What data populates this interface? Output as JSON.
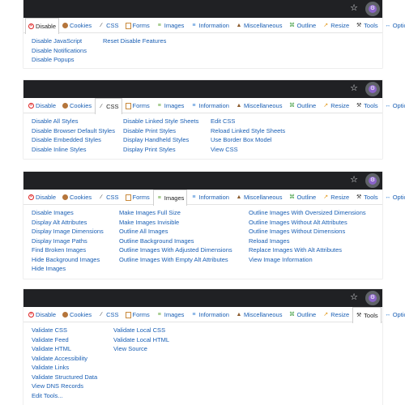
{
  "tabs": [
    {
      "key": "disable",
      "label": "Disable",
      "icon": "disable-icon"
    },
    {
      "key": "cookies",
      "label": "Cookies",
      "icon": "cookie-icon"
    },
    {
      "key": "css",
      "label": "CSS",
      "icon": "brush-icon"
    },
    {
      "key": "forms",
      "label": "Forms",
      "icon": "form-icon"
    },
    {
      "key": "images",
      "label": "Images",
      "icon": "image-icon"
    },
    {
      "key": "information",
      "label": "Information",
      "icon": "info-icon"
    },
    {
      "key": "miscellaneous",
      "label": "Miscellaneous",
      "icon": "misc-icon"
    },
    {
      "key": "outline",
      "label": "Outline",
      "icon": "outline-icon"
    },
    {
      "key": "resize",
      "label": "Resize",
      "icon": "resize-icon"
    },
    {
      "key": "tools",
      "label": "Tools",
      "icon": "tools-icon"
    },
    {
      "key": "options",
      "label": "Options",
      "icon": "options-icon"
    }
  ],
  "panels": [
    {
      "active_tab": "disable",
      "columns": [
        [
          "Disable JavaScript",
          "Disable Notifications",
          "Disable Popups"
        ],
        [
          "Reset Disable Features"
        ]
      ]
    },
    {
      "active_tab": "css",
      "columns": [
        [
          "Disable All Styles",
          "Disable Browser Default Styles",
          "Disable Embedded Styles",
          "Disable Inline Styles"
        ],
        [
          "Disable Linked Style Sheets",
          "Disable Print Styles",
          "Display Handheld Styles",
          "Display Print Styles"
        ],
        [
          "Edit CSS",
          "Reload Linked Style Sheets",
          "Use Border Box Model",
          "View CSS"
        ]
      ]
    },
    {
      "active_tab": "images",
      "columns": [
        [
          "Disable Images",
          "Display Alt Attributes",
          "Display Image Dimensions",
          "Display Image Paths",
          "Find Broken Images",
          "Hide Background Images",
          "Hide Images"
        ],
        [
          "Make Images Full Size",
          "Make Images Invisible",
          "Outline All Images",
          "Outline Background Images",
          "Outline Images With Adjusted Dimensions",
          "Outline Images With Empty Alt Attributes"
        ],
        [
          "Outline Images With Oversized Dimensions",
          "Outline Images Without Alt Attributes",
          "Outline Images Without Dimensions",
          "Reload Images",
          "Replace Images With Alt Attributes",
          "View Image Information"
        ]
      ]
    },
    {
      "active_tab": "tools",
      "columns": [
        [
          "Validate CSS",
          "Validate Feed",
          "Validate HTML",
          "Validate Accessibility",
          "Validate Links",
          "Validate Structured Data",
          "View DNS Records",
          "Edit Tools..."
        ],
        [
          "Validate Local CSS",
          "Validate Local HTML",
          "View Source"
        ]
      ]
    }
  ]
}
